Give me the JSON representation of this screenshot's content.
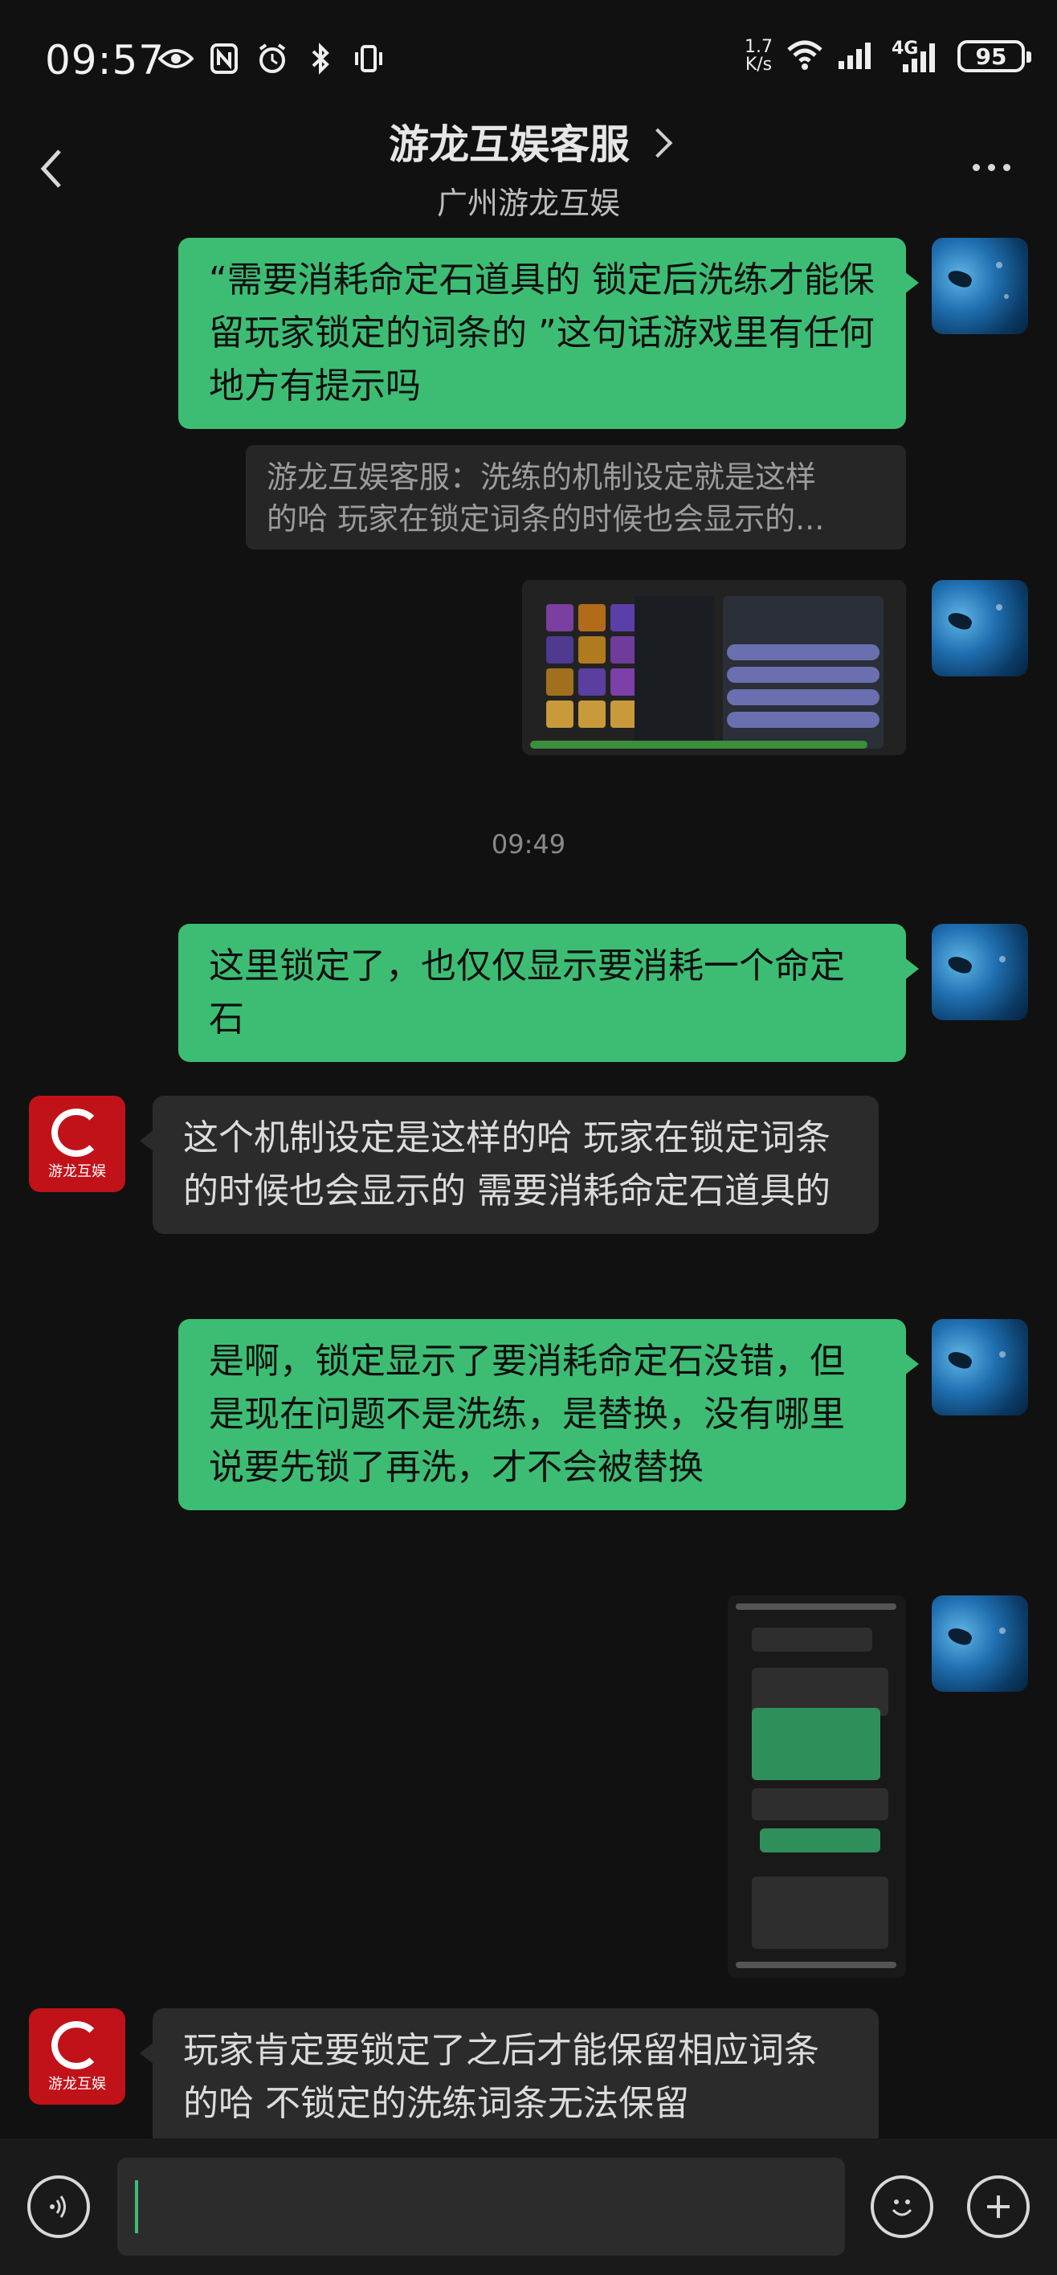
{
  "status_bar": {
    "time": "09:57",
    "net_speed_value": "1.7",
    "net_speed_unit": "K/s",
    "signal_label": "4G",
    "battery": "95"
  },
  "header": {
    "title": "游龙互娱客服",
    "subtitle": "广州游龙互娱"
  },
  "messages": [
    {
      "from": "me",
      "text": "“需要消耗命定石道具的 锁定后洗练才能保留玩家锁定的词条的 ”这句话游戏里有任何地方有提示吗"
    },
    {
      "quote_line1": "游龙互娱客服：洗练的机制设定就是这样",
      "quote_line2": "的哈 玩家在锁定词条的时候也会显示的..."
    },
    {
      "from": "me",
      "type": "image",
      "image": "game-screenshot"
    },
    {
      "timestamp": "09:49"
    },
    {
      "from": "me",
      "text": "这里锁定了，也仅仅显示要消耗一个命定石"
    },
    {
      "from": "bot",
      "text": "这个机制设定是这样的哈 玩家在锁定词条的时候也会显示的 需要消耗命定石道具的"
    },
    {
      "from": "me",
      "text": "是啊，锁定显示了要消耗命定石没错，但是现在问题不是洗练，是替换，没有哪里说要先锁了再洗，才不会被替换"
    },
    {
      "from": "me",
      "type": "image",
      "image": "chat-screenshot"
    },
    {
      "from": "bot",
      "text": "玩家肯定要锁定了之后才能保留相应词条的哈 不锁定的洗练词条无法保留"
    }
  ],
  "bot_avatar": {
    "label": "游龙互娱",
    "color": "#c1121a"
  },
  "colors": {
    "accent": "#3dbd74",
    "background": "#111111",
    "bot_bubble": "#2b2b2b"
  }
}
